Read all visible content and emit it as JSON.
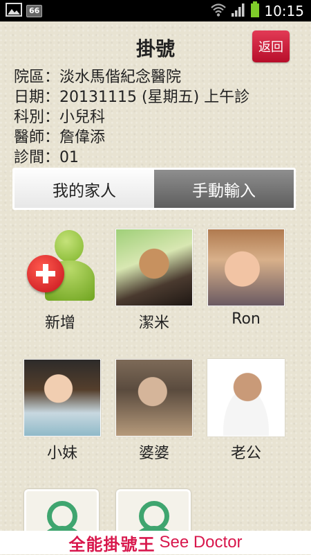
{
  "status_bar": {
    "notification_badge": "66",
    "time": "10:15",
    "icons": [
      "image-icon",
      "wifi-icon",
      "signal-icon",
      "battery-icon"
    ]
  },
  "header": {
    "title": "掛號",
    "back_label": "返回",
    "back_color": "#d0203e"
  },
  "info": [
    {
      "label": "院區",
      "sep": "：",
      "value": "淡水馬偕紀念醫院"
    },
    {
      "label": "日期",
      "sep": "：",
      "value": "20131115 (星期五) 上午診"
    },
    {
      "label": "科別",
      "sep": "：",
      "value": "小兒科"
    },
    {
      "label": "醫師",
      "sep": "：",
      "value": "詹偉添"
    },
    {
      "label": "診間",
      "sep": "：",
      "value": "01"
    }
  ],
  "tabs": [
    {
      "label": "我的家人",
      "state": "inactive"
    },
    {
      "label": "手動輸入",
      "state": "active"
    }
  ],
  "members": [
    {
      "name": "新增",
      "type": "add"
    },
    {
      "name": "潔米",
      "type": "photo"
    },
    {
      "name": "Ron",
      "type": "photo"
    },
    {
      "name": "小妹",
      "type": "photo"
    },
    {
      "name": "婆婆",
      "type": "photo"
    },
    {
      "name": "老公",
      "type": "photo"
    }
  ],
  "footer": {
    "brand_cn": "全能掛號王",
    "brand_en": "See Doctor",
    "brand_color": "#d8174c"
  }
}
